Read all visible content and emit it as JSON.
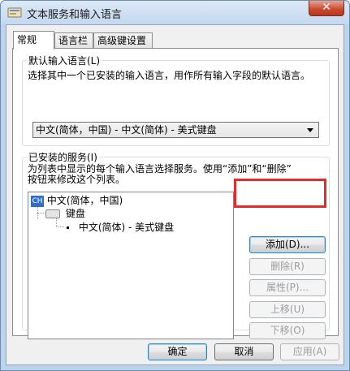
{
  "window": {
    "title": "文本服务和输入语言",
    "close_glyph": "✕"
  },
  "tabs": [
    "常规",
    "语言栏",
    "高级键设置"
  ],
  "default_input": {
    "group_label": "默认输入语言(L)",
    "description": "选择其中一个已安装的输入语言，用作所有输入字段的默认语言。",
    "selected": "中文(简体，中国) - 中文(简体) - 美式键盘"
  },
  "installed_services": {
    "group_label": "已安装的服务(I)",
    "description_line1": "为列表中显示的每个输入语言选择服务。使用“添加”和“删除”",
    "description_line2": "按钮来修改这个列表。",
    "tree": {
      "language_badge": "CH",
      "language": "中文(简体，中国)",
      "category": "键盘",
      "service": "中文(简体) - 美式键盘"
    },
    "buttons": {
      "add": "添加(D)...",
      "remove": "删除(R)",
      "properties": "属性(P)...",
      "move_up": "上移(U)",
      "move_down": "下移(O)"
    }
  },
  "footer": {
    "ok": "确定",
    "cancel": "取消",
    "apply": "应用(A)"
  },
  "colors": {
    "highlight_border": "#e32b2b",
    "title_bar": "#c4d8ef"
  }
}
